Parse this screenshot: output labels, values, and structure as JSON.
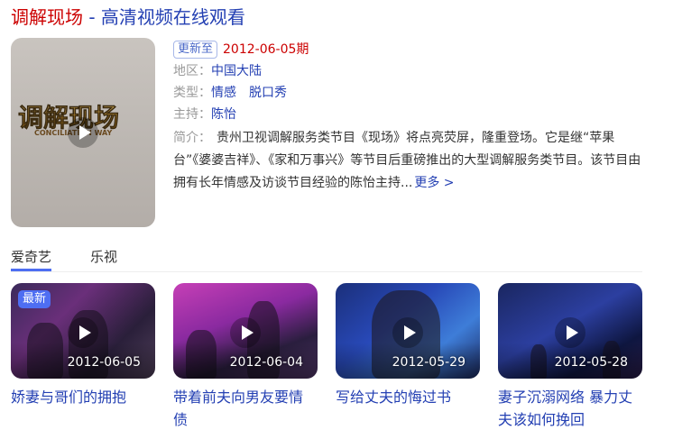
{
  "header": {
    "title_name": "调解现场",
    "title_rest": " - 高清视频在线观看"
  },
  "poster": {
    "logo_text": "调解现场",
    "logo_subtext": "CONCILIATION WAY",
    "icon": "play-icon"
  },
  "info": {
    "update_tag": "更新至",
    "update_date": "2012-06-05期",
    "region_label": "地区：",
    "region_value": "中国大陆",
    "genre_label": "类型：",
    "genres": [
      "情感",
      "脱口秀"
    ],
    "host_label": "主持：",
    "host_value": "陈怡",
    "desc_label": "简介：",
    "desc_text": "贵州卫视调解服务类节目《现场》将点亮荧屏，隆重登场。它是继“苹果台”《婆婆吉祥》、《家和万事兴》等节目后重磅推出的大型调解服务类节目。该节目由拥有长年情感及访谈节目经验的陈怡主持...",
    "more_label": "更多 >"
  },
  "tabs": [
    {
      "label": "爱奇艺",
      "active": true
    },
    {
      "label": "乐视",
      "active": false
    }
  ],
  "episodes": [
    {
      "title": "娇妻与哥们的拥抱",
      "date": "2012-06-05",
      "badge": "最新"
    },
    {
      "title": "带着前夫向男友要情债",
      "date": "2012-06-04"
    },
    {
      "title": "写给丈夫的悔过书",
      "date": "2012-05-29"
    },
    {
      "title": "妻子沉溺网络 暴力丈夫该如何挽回",
      "date": "2012-05-28"
    }
  ],
  "colors": {
    "link_blue": "#2440b3",
    "title_red": "#cc0000",
    "tab_accent": "#4e6ef2"
  }
}
